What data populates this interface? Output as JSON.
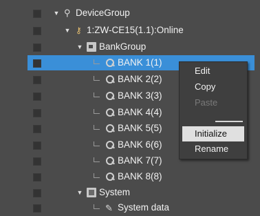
{
  "tree": {
    "nodes": [
      {
        "label": "DeviceGroup",
        "icon": "device-group-icon"
      },
      {
        "label": "1:ZW-CE15(1.1):Online",
        "icon": "device-icon"
      },
      {
        "label": "BankGroup",
        "icon": "folder-icon"
      },
      {
        "label": "BANK 1(1)",
        "icon": "bank-icon"
      },
      {
        "label": "BANK 2(2)",
        "icon": "bank-icon"
      },
      {
        "label": "BANK 3(3)",
        "icon": "bank-icon"
      },
      {
        "label": "BANK 4(4)",
        "icon": "bank-icon"
      },
      {
        "label": "BANK 5(5)",
        "icon": "bank-icon"
      },
      {
        "label": "BANK 6(6)",
        "icon": "bank-icon"
      },
      {
        "label": "BANK 7(7)",
        "icon": "bank-icon"
      },
      {
        "label": "BANK 8(8)",
        "icon": "bank-icon"
      },
      {
        "label": "System",
        "icon": "system-folder-icon"
      },
      {
        "label": "System data",
        "icon": "wrench-icon"
      }
    ],
    "selected": "BANK 1(1)"
  },
  "context_menu": {
    "items": [
      {
        "label": "Edit",
        "enabled": true
      },
      {
        "label": "Copy",
        "enabled": true
      },
      {
        "label": "Paste",
        "enabled": false
      },
      {
        "label": "Initialize",
        "enabled": true,
        "hovered": true
      },
      {
        "label": "Rename",
        "enabled": true
      }
    ]
  },
  "colors": {
    "background": "#4b4b4b",
    "selection": "#3a8fd8",
    "menu_background": "#3f3f3f",
    "menu_hover": "#e0e0e0"
  }
}
